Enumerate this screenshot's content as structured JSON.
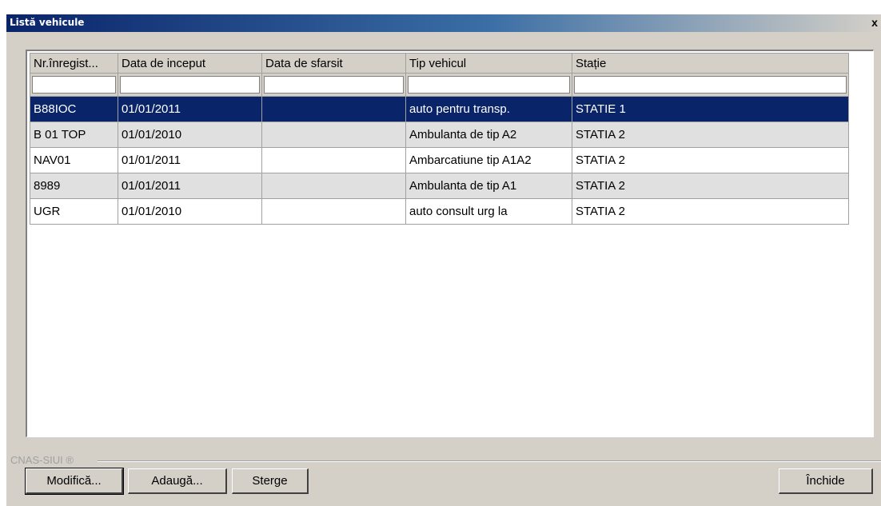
{
  "window": {
    "title": "Listă vehicule",
    "close_glyph": "x"
  },
  "table": {
    "columns": [
      "Nr.înregist...",
      "Data de inceput",
      "Data de sfarsit",
      "Tip vehicul",
      "Stație"
    ],
    "filters": [
      "",
      "",
      "",
      "",
      ""
    ],
    "rows": [
      {
        "nr": "B88IOC",
        "start": "01/01/2011",
        "end": "",
        "tip": "auto pentru transp.",
        "statie": "STATIE 1",
        "selected": true
      },
      {
        "nr": "B 01 TOP",
        "start": "01/01/2010",
        "end": "",
        "tip": "Ambulanta de tip A2",
        "statie": "STATIA 2"
      },
      {
        "nr": "NAV01",
        "start": "01/01/2011",
        "end": "",
        "tip": "Ambarcatiune tip A1A2",
        "statie": "STATIA 2"
      },
      {
        "nr": "8989",
        "start": "01/01/2011",
        "end": "",
        "tip": "Ambulanta de tip A1",
        "statie": "STATIA 2"
      },
      {
        "nr": "UGR",
        "start": "01/01/2010",
        "end": "",
        "tip": "auto consult urg la",
        "statie": "STATIA 2"
      }
    ]
  },
  "footer": {
    "group_label": "CNAS-SIUI ®",
    "modifica": "Modifică...",
    "adauga": "Adaugă...",
    "sterge": "Sterge",
    "inchide": "Închide"
  },
  "colors": {
    "selection": "#0a246a",
    "alt_row": "#e0e0e0",
    "face": "#d4d0c8"
  }
}
